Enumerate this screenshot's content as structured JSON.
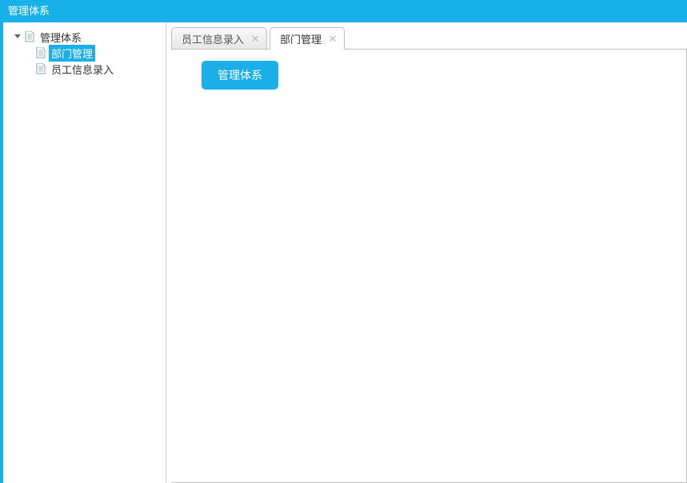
{
  "header": {
    "title": "管理体系"
  },
  "sidebar": {
    "root": {
      "label": "管理体系"
    },
    "children": [
      {
        "label": "部门管理",
        "selected": true
      },
      {
        "label": "员工信息录入",
        "selected": false
      }
    ]
  },
  "tabs": [
    {
      "label": "员工信息录入",
      "active": false
    },
    {
      "label": "部门管理",
      "active": true
    }
  ],
  "content": {
    "button_label": "管理体系"
  }
}
